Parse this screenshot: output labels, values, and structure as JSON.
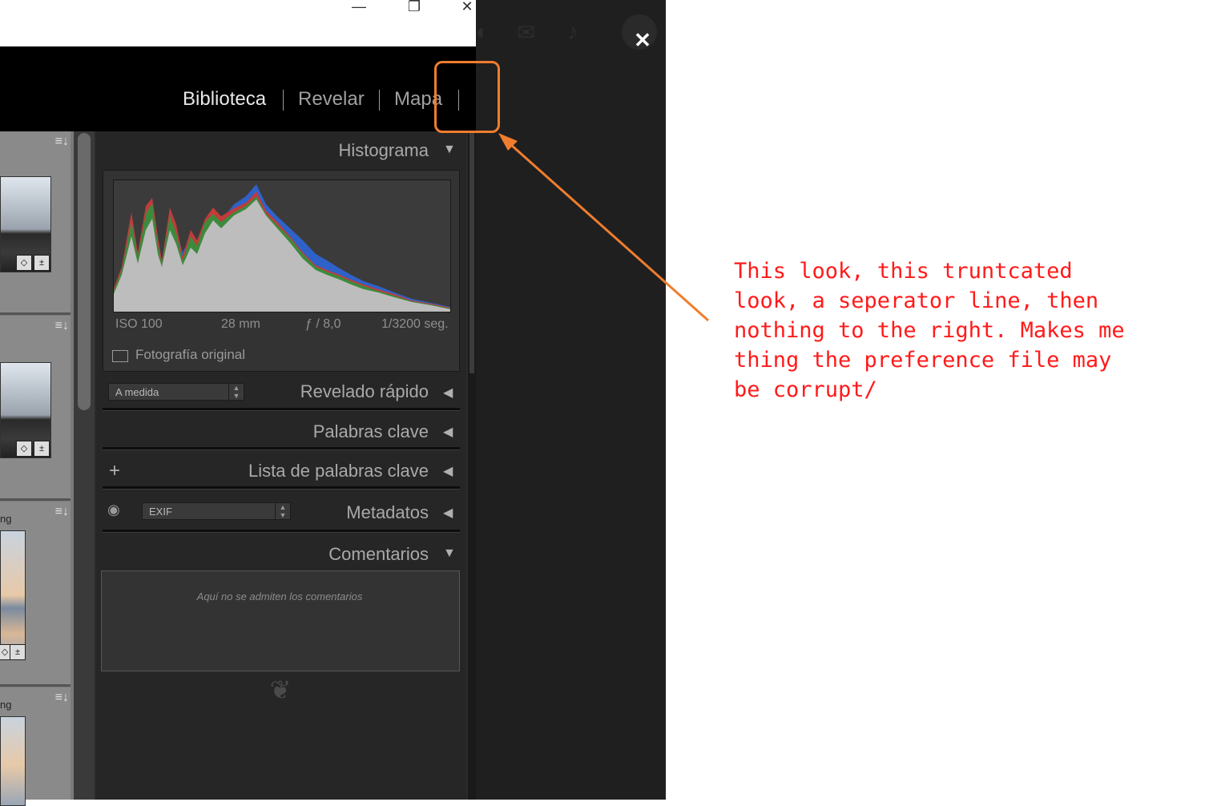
{
  "window": {
    "minimize": "—",
    "restore": "❐",
    "close": "✕"
  },
  "overlay": {
    "close": "✕"
  },
  "modules": [
    {
      "label": "Biblioteca",
      "active": true
    },
    {
      "label": "Revelar",
      "active": false
    },
    {
      "label": "Mapa",
      "active": false
    }
  ],
  "filmstrip": {
    "cell_caption": "ng"
  },
  "panels": {
    "histogram": {
      "title": "Histograma",
      "iso": "ISO 100",
      "focal": "28 mm",
      "aperture": "ƒ / 8,0",
      "shutter": "1/3200 seg.",
      "original_label": "Fotografía original"
    },
    "quick_develop": {
      "title": "Revelado rápido",
      "preset": "A medida"
    },
    "keywords": {
      "title": "Palabras clave"
    },
    "keyword_list": {
      "title": "Lista de palabras clave",
      "add": "+"
    },
    "metadata": {
      "title": "Metadatos",
      "preset": "EXIF"
    },
    "comments": {
      "title": "Comentarios",
      "placeholder": "Aquí no se admiten los comentarios"
    }
  },
  "annotation": {
    "text": "This look, this truntcated\nlook, a seperator line, then\nnothing to the right. Makes me\nthing the preference file may\nbe corrupt/",
    "color": "#ff1a1a",
    "highlight_color": "#f07d2d"
  },
  "colors": {
    "panel_bg": "#262626",
    "topbar_bg": "#000000",
    "active_module": "#e8e8e8",
    "inactive_module": "#a0a0a0"
  }
}
